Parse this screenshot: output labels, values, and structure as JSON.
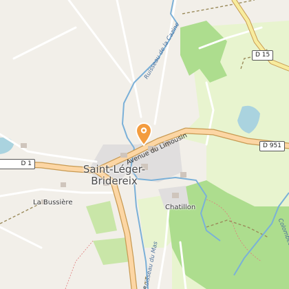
{
  "map": {
    "colors": {
      "background": "#f2efe9",
      "meadow": "#e8f4cf",
      "forest": "#addd8e",
      "water": "#aad3df",
      "stream": "#7ab0d8",
      "primary_road": "#fcd6a4",
      "road_casing": "#d4a45a",
      "residential": "#e0dede",
      "marker": "#f39c3f"
    },
    "marker": {
      "name": "location-pin"
    },
    "place_labels": {
      "town_line1": "Saint-Léger-",
      "town_line2": "Bridereix",
      "la_bussiere": "La Bussière",
      "chatillon": "Chatillon"
    },
    "road_shields": {
      "d15": "D 15",
      "d951": "D 951",
      "d1_partial": "D 1"
    },
    "road_labels": {
      "avenue": "Avenue du Limousin"
    },
    "waterway_labels": {
      "cazine": "Ruisseau de la Cazine",
      "mas": "Ruisseau du Mas",
      "colombeaux": "Colombeaux"
    }
  }
}
